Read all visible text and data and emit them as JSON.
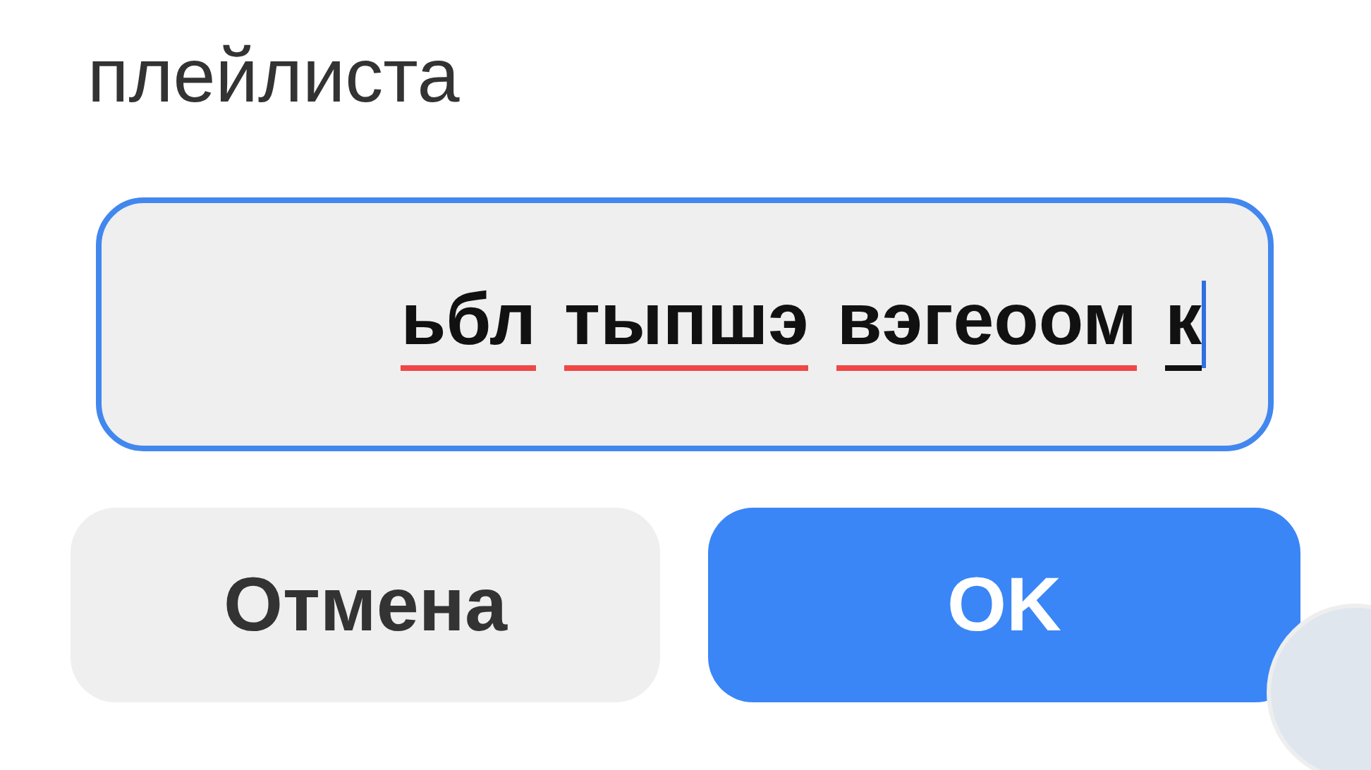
{
  "dialog": {
    "title": "плейлиста",
    "input": {
      "words": [
        {
          "text": "ьбл",
          "kind": "misspelled"
        },
        {
          "text": "тыпшэ",
          "kind": "misspelled"
        },
        {
          "text": "вэгеоом",
          "kind": "misspelled"
        },
        {
          "text": "к",
          "kind": "composing"
        }
      ]
    },
    "buttons": [
      {
        "label": "Отмена",
        "kind": "secondary"
      },
      {
        "label": "OK",
        "kind": "primary"
      }
    ]
  }
}
